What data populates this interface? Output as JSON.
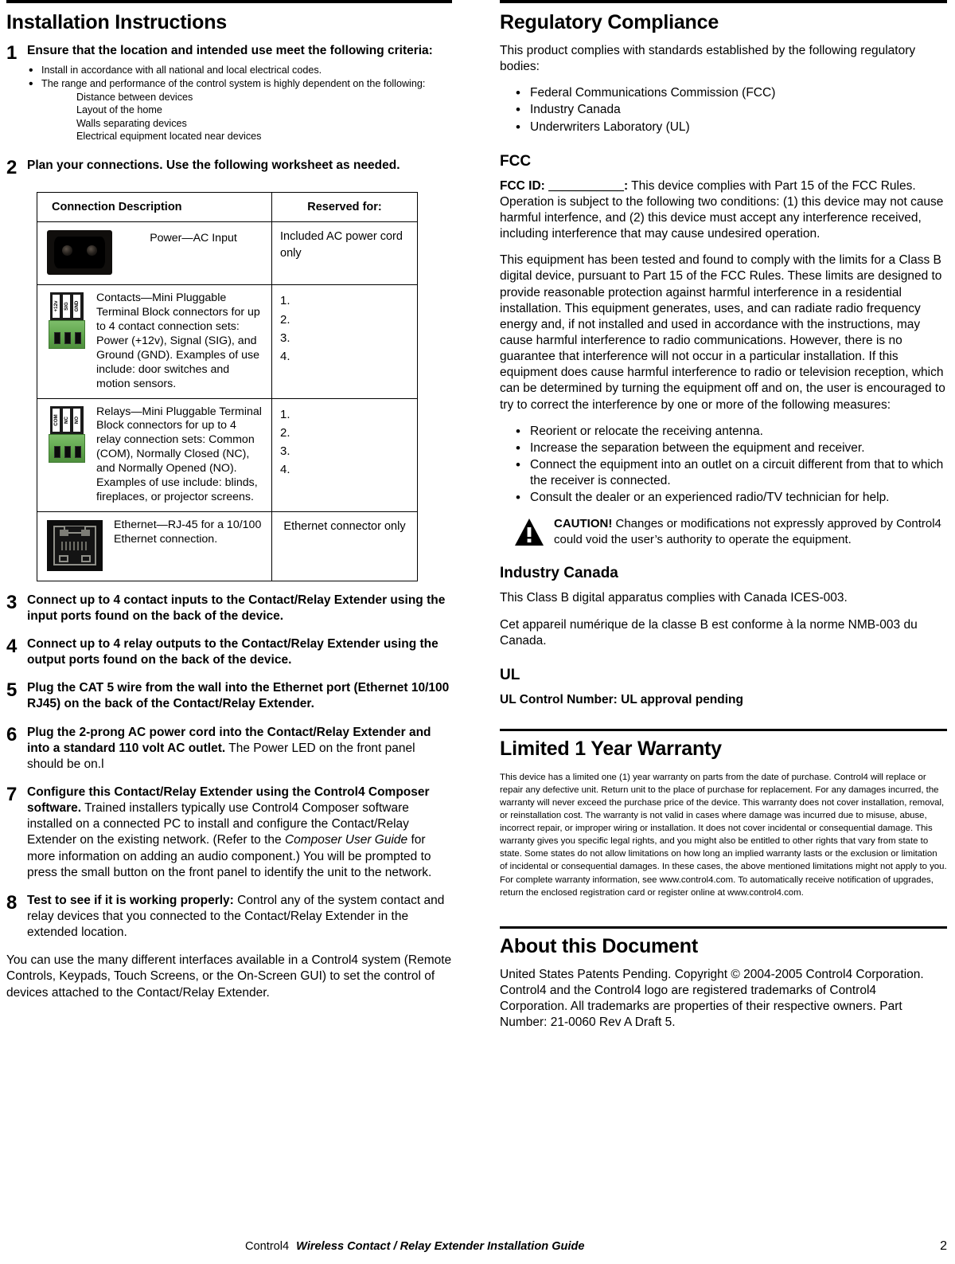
{
  "left_column": {
    "title": "Installation Instructions",
    "steps": [
      {
        "num": "1",
        "lead": "Ensure that the location and intended use meet the following criteria:",
        "bullets": [
          "Install in accordance with all national and local electrical codes.",
          "The range and performance of the control system is highly dependent on the following:"
        ],
        "sub_items": [
          "Distance between devices",
          "Layout of the home",
          "Walls separating devices",
          "Electrical equipment located near devices"
        ]
      },
      {
        "num": "2",
        "lead": "Plan your connections. Use the following worksheet as needed."
      },
      {
        "num": "3",
        "lead": "Connect up to 4 contact inputs to the Contact/Relay Extender using the input ports found on the back of the device."
      },
      {
        "num": "4",
        "lead": "Connect up to 4 relay outputs to the Contact/Relay Extender using the output ports found on the back of the device."
      },
      {
        "num": "5",
        "lead": "Plug the CAT 5 wire from the wall into the Ethernet port (Ethernet 10/100 RJ45) on the back of the Contact/Relay Extender."
      },
      {
        "num": "6",
        "lead": "Plug the 2-prong AC power cord into the Contact/Relay Extender and into a standard 110 volt AC outlet.",
        "rest": " The Power LED on the front panel should be on.l"
      },
      {
        "num": "7",
        "lead": "Configure this Contact/Relay Extender using the Control4 Composer software.",
        "rest_a": " Trained installers typically use Control4 Composer software installed on a connected PC to install and configure the Contact/Relay Extender on the existing network. (Refer to the ",
        "italic": "Composer User Guide",
        "rest_b": " for more information on adding an audio component.) You will be prompted to press the small button on the front panel to identify the unit to the network."
      },
      {
        "num": "8",
        "lead": "Test to see if it is working properly:",
        "rest": " Control any of the system contact and relay devices that you connected to the Contact/Relay Extender in the extended location."
      }
    ],
    "closing_paragraph": "You can use the many different interfaces available in a Control4 system (Remote Controls, Keypads, Touch Screens, or the On-Screen GUI) to set the control of devices attached to the Contact/Relay Extender."
  },
  "worksheet": {
    "headers": [
      "Connection Description",
      "Reserved for:"
    ],
    "rows": [
      {
        "icon": "ac-power-inlet-icon",
        "description": "Power—AC Input",
        "description_align": "center",
        "reserved": "Included AC power cord only",
        "reserved_align": "left"
      },
      {
        "icon": "contacts-terminal-block-icon",
        "icon_labels": [
          "+12v",
          "SIG",
          "GND"
        ],
        "description": "Contacts—Mini Pluggable Terminal Block connectors for up to 4 contact connection sets: Power (+12v), Signal (SIG), and Ground (GND). Examples of use include: door switches and motion sensors.",
        "description_align": "left",
        "reserved_numbered": [
          "1.",
          "2.",
          "3.",
          "4."
        ]
      },
      {
        "icon": "relays-terminal-block-icon",
        "icon_labels": [
          "COM",
          "NC",
          "NO"
        ],
        "description": "Relays—Mini Pluggable Terminal Block connectors for up to 4 relay connection sets: Common (COM), Normally Closed (NC), and Normally Opened (NO). Examples of use include: blinds, fireplaces, or projector screens.",
        "description_align": "left",
        "reserved_numbered": [
          "1.",
          "2.",
          "3.",
          "4."
        ]
      },
      {
        "icon": "rj45-ethernet-jack-icon",
        "description": "Ethernet—RJ-45 for a 10/100 Ethernet connection.",
        "description_align": "left",
        "reserved": "Ethernet connector only",
        "reserved_align": "center"
      }
    ]
  },
  "right_column": {
    "regulatory": {
      "title": "Regulatory Compliance",
      "intro": "This product complies with standards established by the following regulatory bodies:",
      "bodies": [
        "Federal Communications Commission (FCC)",
        "Industry Canada",
        "Underwriters Laboratory (UL)"
      ],
      "fcc": {
        "heading": "FCC",
        "id_label": "FCC ID:",
        "id_blank": "___________",
        "id_colon": ":",
        "id_paragraph": " This device complies with Part 15 of the FCC Rules. Operation is subject to the following two conditions: (1) this device may not cause harmful interfence, and (2) this device must accept any interference received, including interference that may cause undesired operation.",
        "paragraph2": "This equipment has been tested and found to comply with the limits for a Class B digital device, pursuant to Part 15 of the FCC Rules. These limits are designed to provide reasonable protection against harmful interference in a residential installation. This equipment generates, uses, and can radiate radio frequency energy and, if not installed and used in accordance with the instructions, may cause harmful interference to radio communications. However, there is no guarantee that interference will not occur in a particular installation. If this equipment does cause harmful interference to radio or television reception, which can be determined by turning the equipment off and on, the user is encouraged to try to correct the interference by one or more of the following measures:",
        "measures": [
          "Reorient or relocate the receiving antenna.",
          "Increase the separation between the equipment and receiver.",
          "Connect the equipment into an outlet on a circuit different from that to which the receiver is connected.",
          "Consult the dealer or an experienced radio/TV technician for help."
        ],
        "caution_label": "CAUTION!",
        "caution_text": " Changes or modifications not expressly approved by Control4 could void the user’s authority to operate the equipment."
      },
      "industry_canada": {
        "heading": "Industry Canada",
        "paragraph_en": "This Class B digital apparatus complies with Canada ICES-003.",
        "paragraph_fr": "Cet appareil numérique de la classe B est conforme à la norme NMB-003 du Canada."
      },
      "ul": {
        "heading": "UL",
        "control_number": "UL Control Number: UL approval pending"
      }
    },
    "warranty": {
      "title": "Limited 1 Year Warranty",
      "text": "This device has a limited one (1) year warranty on parts from the date of purchase. Control4 will replace or repair any defective unit. Return unit to the place of purchase for replacement. For any damages incurred, the warranty will never exceed the purchase price of the device. This warranty does not cover installation, removal, or reinstallation cost. The warranty is not valid in cases where damage was incurred due to misuse, abuse, incorrect repair, or improper wiring or installation. It does not cover incidental or consequential damage. This warranty gives you specific legal rights, and you might also be entitled to other rights that vary from state to state. Some states do not allow limitations on how long an implied warranty lasts or the exclusion or limitation of incidental or consequential damages. In these cases, the above mentioned limitations might not apply to you. For complete warranty information, see www.control4.com. To automatically receive notification of upgrades, return the enclosed registration card or register online at www.control4.com."
    },
    "about": {
      "title": "About this Document",
      "text": "United States Patents Pending. Copyright © 2004-2005 Control4 Corporation. Control4 and the Control4 logo are registered trademarks of Control4 Corporation. All trademarks are properties of their respective owners. Part Number: 21-0060 Rev A Draft 5."
    }
  },
  "footer": {
    "brand": "Control4",
    "guide": "Wireless Contact / Relay Extender Installation Guide",
    "page_number": "2"
  }
}
